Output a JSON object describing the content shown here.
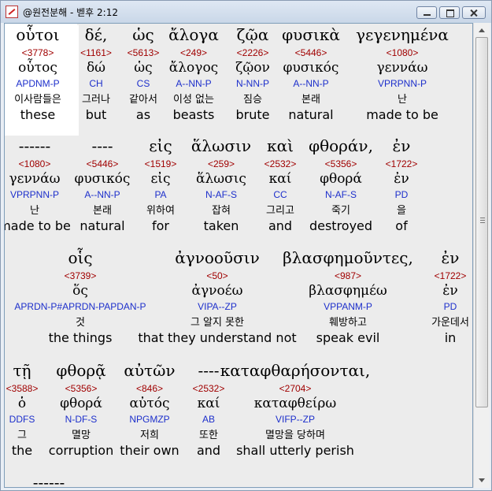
{
  "window": {
    "title": "@원전분해 - 벧후 2:12"
  },
  "rows": [
    {
      "y": 0,
      "cells": [
        {
          "greek": "οὗτοι",
          "strong": "<3778>",
          "lemma": "οὗτος",
          "morph": "APDNM-P",
          "korean": "이사람들은",
          "english": "these"
        },
        {
          "greek": "δέ,",
          "strong": "<1161>",
          "lemma": "δώ",
          "morph": "CH",
          "korean": "그러나",
          "english": "but"
        },
        {
          "greek": "ὡς",
          "strong": "<5613>",
          "lemma": "ὡς",
          "morph": "CS",
          "korean": "같아서",
          "english": "as"
        },
        {
          "greek": "ἄλογα",
          "strong": "<249>",
          "lemma": "ἄλογος",
          "morph": "A--NN-P",
          "korean": "이성 없는",
          "english": "beasts"
        },
        {
          "greek": "ζῷα",
          "strong": "<2226>",
          "lemma": "ζῷον",
          "morph": "N-NN-P",
          "korean": "짐승",
          "english": "brute"
        },
        {
          "greek": "φυσικὰ",
          "strong": "<5446>",
          "lemma": "φυσικός",
          "morph": "A--NN-P",
          "korean": "본래",
          "english": "natural"
        },
        {
          "greek": "γεγενημένα",
          "strong": "<1080>",
          "lemma": "γεννάω",
          "morph": "VPRPNN-P",
          "korean": "난",
          "english": "made to be"
        }
      ]
    },
    {
      "cells": [
        {
          "greek": "------",
          "strong": "<1080>",
          "lemma": "γεννάω",
          "morph": "VPRPNN-P",
          "korean": "난",
          "english": "made to be"
        },
        {
          "greek": "----",
          "strong": "<5446>",
          "lemma": "φυσικός",
          "morph": "A--NN-P",
          "korean": "본래",
          "english": "natural"
        },
        {
          "greek": "εἰς",
          "strong": "<1519>",
          "lemma": "εἰς",
          "morph": "PA",
          "korean": "위하여",
          "english": "for"
        },
        {
          "greek": "ἅλωσιν",
          "strong": "<259>",
          "lemma": "ἅλωσις",
          "morph": "N-AF-S",
          "korean": "잡혀",
          "english": "taken"
        },
        {
          "greek": "καὶ",
          "strong": "<2532>",
          "lemma": "καί",
          "morph": "CC",
          "korean": "그리고",
          "english": "and"
        },
        {
          "greek": "φθοράν,",
          "strong": "<5356>",
          "lemma": "φθορά",
          "morph": "N-AF-S",
          "korean": "죽기",
          "english": "destroyed"
        },
        {
          "greek": "ἐν",
          "strong": "<1722>",
          "lemma": "ἐν",
          "morph": "PD",
          "korean": "을",
          "english": "of"
        }
      ]
    },
    {
      "cells": [
        {
          "greek": "οἷς",
          "strong": "<3739>",
          "lemma": "ὅς",
          "morph": "APRDN-P#APRDN-PAPDAN-P",
          "korean": "것",
          "english": "the things"
        },
        {
          "greek": "ἀγνοοῦσιν",
          "strong": "<50>",
          "lemma": "ἀγνοέω",
          "morph": "VIPA--ZP",
          "korean": "그 알지 못한",
          "english": "that they understand not"
        },
        {
          "greek": "βλασφημοῦντες,",
          "strong": "<987>",
          "lemma": "βλασφημέω",
          "morph": "VPPANM-P",
          "korean": "훼방하고",
          "english": "speak evil"
        },
        {
          "greek": "ἐν",
          "strong": "<1722>",
          "lemma": "ἐν",
          "morph": "PD",
          "korean": "가운데서",
          "english": "in"
        }
      ]
    },
    {
      "cells": [
        {
          "greek": "τῇ",
          "strong": "<3588>",
          "lemma": "ὁ",
          "morph": "DDFS",
          "korean": "그",
          "english": "the"
        },
        {
          "greek": "φθορᾷ",
          "strong": "<5356>",
          "lemma": "φθορά",
          "morph": "N-DF-S",
          "korean": "멸망",
          "english": "corruption"
        },
        {
          "greek": "αὐτῶν",
          "strong": "<846>",
          "lemma": "αὐτός",
          "morph": "NPGMZP",
          "korean": "저희",
          "english": "their own"
        },
        {
          "greek": "----",
          "strong": "<2532>",
          "lemma": "καί",
          "morph": "AB",
          "korean": "또한",
          "english": "and"
        },
        {
          "greek": "καταφθαρήσονται,",
          "strong": "<2704>",
          "lemma": "καταφθείρω",
          "morph": "VIFP--ZP",
          "korean": "멸망을 당하며",
          "english": "shall utterly perish"
        }
      ]
    },
    {
      "cells": [
        {
          "greek": "------"
        }
      ]
    }
  ]
}
